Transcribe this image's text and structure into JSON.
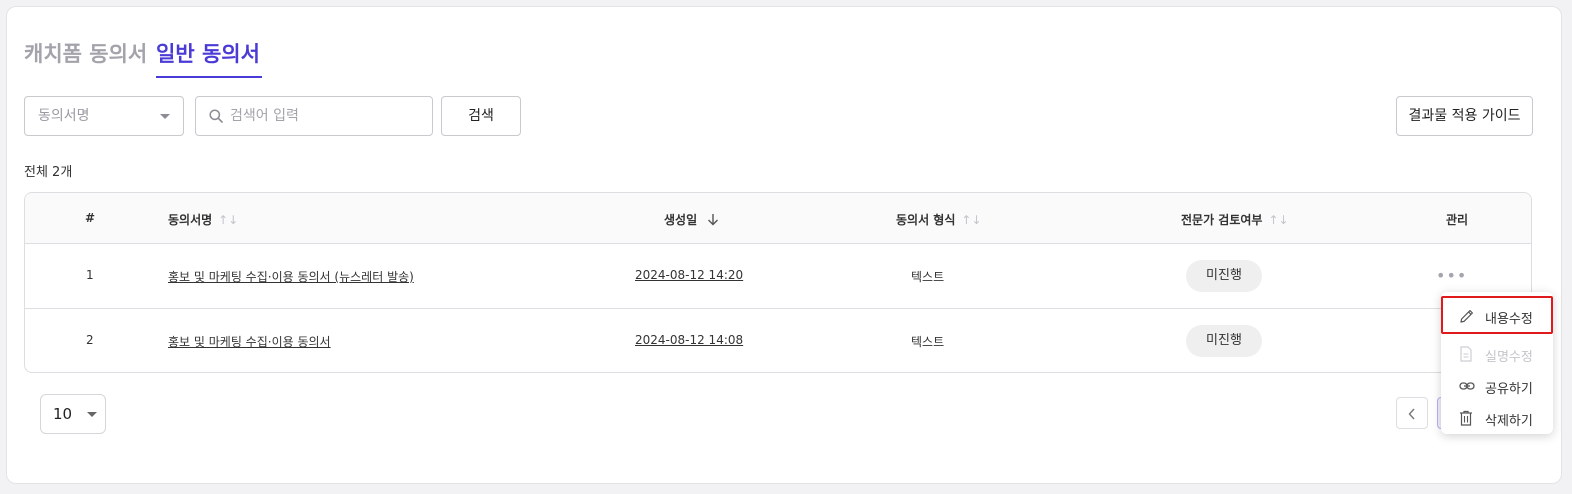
{
  "tabs": [
    {
      "label": "캐치폼 동의서",
      "active": false
    },
    {
      "label": "일반 동의서",
      "active": true
    }
  ],
  "filters": {
    "select_value": "동의서명",
    "search_placeholder": "검색어 입력",
    "search_button": "검색",
    "guide_button": "결과물 적용 가이드"
  },
  "total_label": "전체 2개",
  "table": {
    "headers": {
      "index": "#",
      "name": "동의서명",
      "created": "생성일",
      "format": "동의서 형식",
      "review": "전문가 검토여부",
      "manage": "관리"
    },
    "rows": [
      {
        "index": "1",
        "name": "홍보 및 마케팅 수집·이용 동의서 (뉴스레터 발송)",
        "created": "2024-08-12 14:20",
        "format": "텍스트",
        "review": "미진행",
        "more": "•••"
      },
      {
        "index": "2",
        "name": "홍보 및 마케팅 수집·이용 동의서",
        "created": "2024-08-12 14:08",
        "format": "텍스트",
        "review": "미진행",
        "more": "•••"
      }
    ]
  },
  "pagination": {
    "page_size": "10"
  },
  "context_menu": {
    "items": [
      {
        "label": "내용수정",
        "icon": "pencil-icon",
        "highlighted": true,
        "disabled": false
      },
      {
        "label": "실명수정",
        "icon": "document-icon",
        "highlighted": false,
        "disabled": true
      },
      {
        "label": "공유하기",
        "icon": "link-icon",
        "highlighted": false,
        "disabled": false
      },
      {
        "label": "삭제하기",
        "icon": "trash-icon",
        "highlighted": false,
        "disabled": false
      }
    ]
  },
  "colors": {
    "accent": "#4b3bd6",
    "highlight_border": "#e0191c"
  }
}
